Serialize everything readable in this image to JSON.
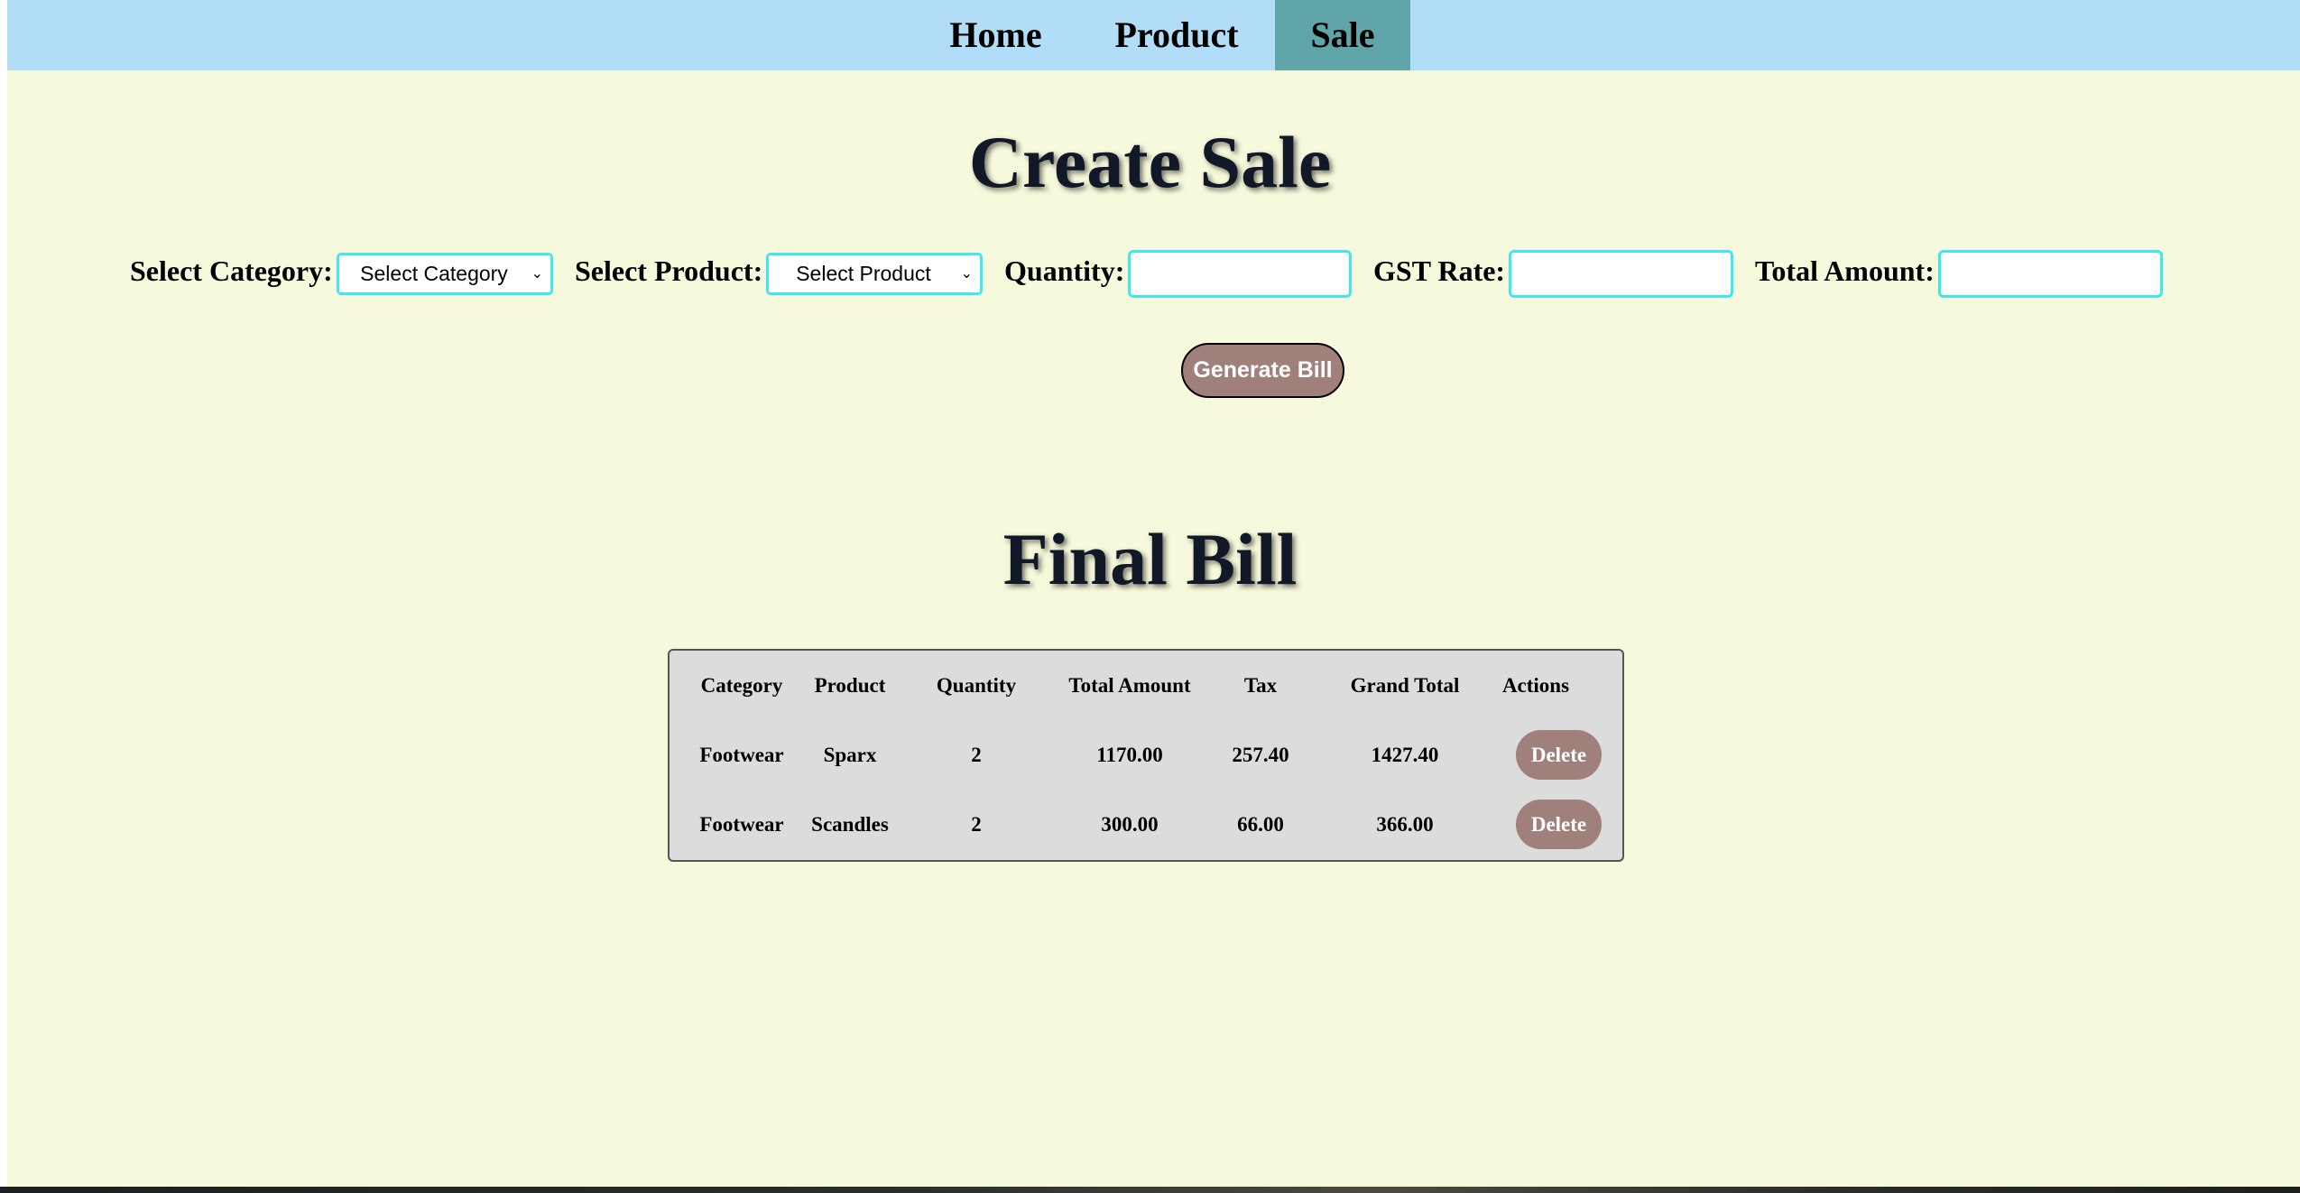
{
  "nav": {
    "items": [
      {
        "label": "Home"
      },
      {
        "label": "Product"
      },
      {
        "label": "Sale"
      }
    ],
    "active": "Sale",
    "bar_color": "#b1def6",
    "active_color": "#5fa5a9"
  },
  "create": {
    "title": "Create Sale",
    "category_label": "Select Category:",
    "category_value": "Select Category",
    "product_label": "Select Product:",
    "product_value": "Select Product",
    "quantity_label": "Quantity:",
    "quantity_value": "",
    "gst_label": "GST Rate:",
    "gst_value": "",
    "total_label": "Total Amount:",
    "total_value": "",
    "generate_label": "Generate Bill"
  },
  "bill": {
    "title": "Final Bill",
    "headers": [
      "Category",
      "Product",
      "Quantity",
      "Total Amount",
      "Tax",
      "Grand Total",
      "Actions"
    ],
    "rows": [
      {
        "category": "Footwear",
        "product": "Sparx",
        "quantity": "2",
        "total": "1170.00",
        "tax": "257.40",
        "grand": "1427.40",
        "action": "Delete"
      },
      {
        "category": "Footwear",
        "product": "Scandles",
        "quantity": "2",
        "total": "300.00",
        "tax": "66.00",
        "grand": "366.00",
        "action": "Delete"
      }
    ]
  },
  "colors": {
    "page_bg": "#f7f9dc",
    "input_border": "#3ee8ee",
    "button_bg": "#a0807a",
    "table_bg": "#dcdcdc"
  }
}
